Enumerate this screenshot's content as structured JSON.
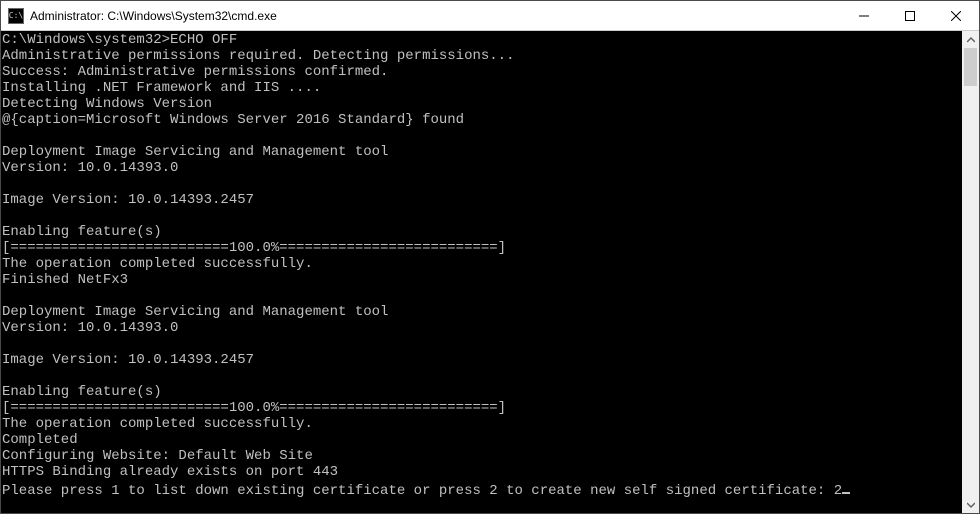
{
  "window": {
    "title": "Administrator: C:\\Windows\\System32\\cmd.exe",
    "icon_text": "C:\\"
  },
  "terminal": {
    "lines": [
      "C:\\Windows\\system32>ECHO OFF",
      "Administrative permissions required. Detecting permissions...",
      "Success: Administrative permissions confirmed.",
      "Installing .NET Framework and IIS ....",
      "Detecting Windows Version",
      "@{caption=Microsoft Windows Server 2016 Standard} found",
      "",
      "Deployment Image Servicing and Management tool",
      "Version: 10.0.14393.0",
      "",
      "Image Version: 10.0.14393.2457",
      "",
      "Enabling feature(s)",
      "[==========================100.0%==========================]",
      "The operation completed successfully.",
      "Finished NetFx3",
      "",
      "Deployment Image Servicing and Management tool",
      "Version: 10.0.14393.0",
      "",
      "Image Version: 10.0.14393.2457",
      "",
      "Enabling feature(s)",
      "[==========================100.0%==========================]",
      "The operation completed successfully.",
      "Completed",
      "Configuring Website: Default Web Site",
      "HTTPS Binding already exists on port 443"
    ],
    "prompt_line": "Please press 1 to list down existing certificate or press 2 to create new self signed certificate: 2"
  }
}
